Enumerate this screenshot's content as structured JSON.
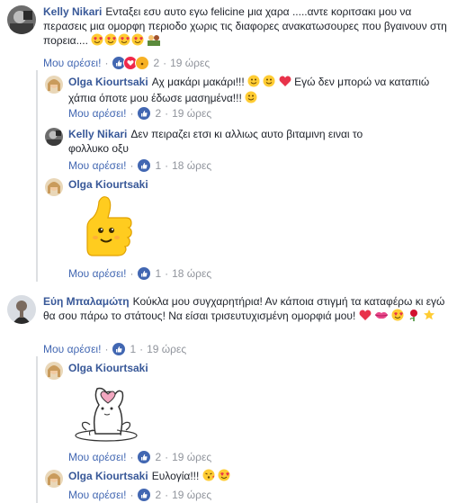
{
  "comments": [
    {
      "author": "Kelly Nikari",
      "text": "Ενταξει εσυ αυτο εγω felicine μια χαρα .....αντε κοριτσακι μου να περασεις μια ομορφη περιοδο χωρις τις διαφορες ανακατωσουρες που βγαινουν στη πορεια....",
      "like": "Μου αρέσει!",
      "count": "2",
      "time": "19 ώρες"
    },
    {
      "author": "Olga Kiourtsaki",
      "text": "Αχ μακάρι μακάρι!!!",
      "text2": "Εγώ δεν μπορώ να καταπιώ χάπια όποτε μου έδωσε μασημένα!!!",
      "like": "Μου αρέσει!",
      "count": "2",
      "time": "19 ώρες"
    },
    {
      "author": "Kelly Nikari",
      "text": "Δεν πειραζει ετσι κι αλλιως αυτο βιταμινη ειναι το φολλυκο οξυ",
      "like": "Μου αρέσει!",
      "count": "1",
      "time": "18 ώρες"
    },
    {
      "author": "Olga Kiourtsaki",
      "like": "Μου αρέσει!",
      "count": "1",
      "time": "18 ώρες"
    },
    {
      "author": "Εύη Μπαλαμώτη",
      "text": "Κούκλα μου συγχαρητήρια! Αν κάποια στιγμή τα καταφέρω κι εγώ θα σου πάρω το στάτους! Να είσαι τρισευτυχισμένη ομορφιά μου!",
      "like": "Μου αρέσει!",
      "count": "1",
      "time": "19 ώρες"
    },
    {
      "author": "Olga Kiourtsaki",
      "like": "Μου αρέσει!",
      "count": "2",
      "time": "19 ώρες"
    },
    {
      "author": "Olga Kiourtsaki",
      "text": "Ευλογία!!!",
      "like": "Μου αρέσει!",
      "count": "2",
      "time": "19 ώρες"
    }
  ],
  "colors": {
    "link": "#385898",
    "like_blue": "#4267b2",
    "meta": "#90949c",
    "love": "#f0284a"
  }
}
